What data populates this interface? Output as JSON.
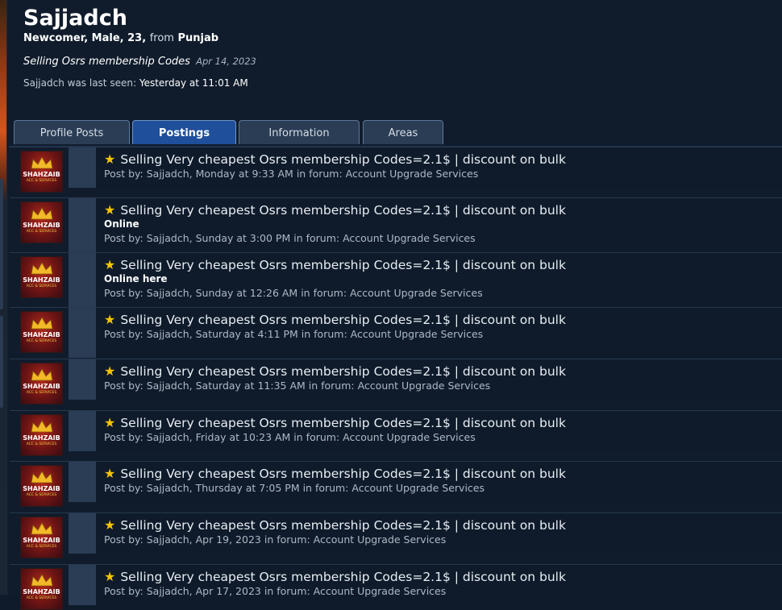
{
  "profile": {
    "username": "Sajjadch",
    "meta_bold": "Newcomer, Male, 23,",
    "meta_from": "from",
    "meta_location": "Punjab",
    "status_text": "Selling Osrs membership Codes",
    "status_date": "Apr 14, 2023",
    "last_seen_prefix": "Sajjadch was last seen:",
    "last_seen_value": "Yesterday at 11:01 AM"
  },
  "tabs": [
    {
      "label": "Profile Posts",
      "active": false
    },
    {
      "label": "Postings",
      "active": true
    },
    {
      "label": "Information",
      "active": false
    },
    {
      "label": "Areas",
      "active": false
    }
  ],
  "avatar": {
    "brand": "SHAHZAIB",
    "sub": "ACC & SERVICES"
  },
  "posts": [
    {
      "title": "Selling Very cheapest Osrs membership Codes=2.1$ | discount on bulk",
      "extra": "",
      "meta": "Post by: Sajjadch, Monday at 9:33 AM in forum: Account Upgrade Services"
    },
    {
      "title": "Selling Very cheapest Osrs membership Codes=2.1$ | discount on bulk",
      "extra": "Online",
      "meta": "Post by: Sajjadch, Sunday at 3:00 PM in forum: Account Upgrade Services"
    },
    {
      "title": "Selling Very cheapest Osrs membership Codes=2.1$ | discount on bulk",
      "extra": "Online here",
      "meta": "Post by: Sajjadch, Sunday at 12:26 AM in forum: Account Upgrade Services"
    },
    {
      "title": "Selling Very cheapest Osrs membership Codes=2.1$ | discount on bulk",
      "extra": "",
      "meta": "Post by: Sajjadch, Saturday at 4:11 PM in forum: Account Upgrade Services"
    },
    {
      "title": "Selling Very cheapest Osrs membership Codes=2.1$ | discount on bulk",
      "extra": "",
      "meta": "Post by: Sajjadch, Saturday at 11:35 AM in forum: Account Upgrade Services"
    },
    {
      "title": "Selling Very cheapest Osrs membership Codes=2.1$ | discount on bulk",
      "extra": "",
      "meta": "Post by: Sajjadch, Friday at 10:23 AM in forum: Account Upgrade Services"
    },
    {
      "title": "Selling Very cheapest Osrs membership Codes=2.1$ | discount on bulk",
      "extra": "",
      "meta": "Post by: Sajjadch, Thursday at 7:05 PM in forum: Account Upgrade Services"
    },
    {
      "title": "Selling Very cheapest Osrs membership Codes=2.1$ | discount on bulk",
      "extra": "",
      "meta": "Post by: Sajjadch, Apr 19, 2023 in forum: Account Upgrade Services"
    },
    {
      "title": "Selling Very cheapest Osrs membership Codes=2.1$ | discount on bulk",
      "extra": "",
      "meta": "Post by: Sajjadch, Apr 17, 2023 in forum: Account Upgrade Services"
    }
  ],
  "colors": {
    "background": "#0f1b2b",
    "active_tab": "#1f4f9a",
    "tab": "#2a3d55",
    "star": "#f5c400"
  },
  "icons": {
    "post_prefix": "star-icon",
    "avatar_emblem": "crown-icon"
  }
}
